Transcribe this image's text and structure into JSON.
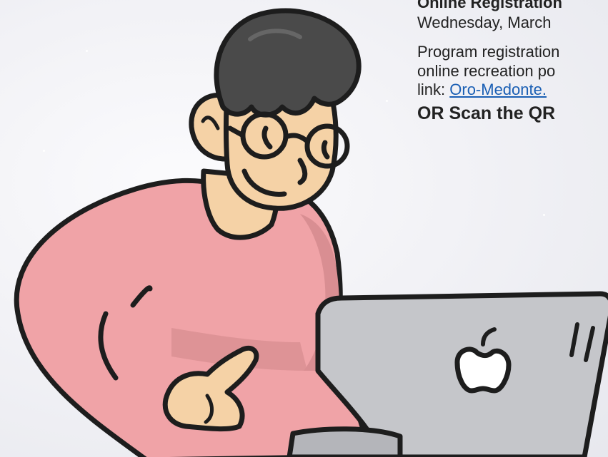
{
  "registration": {
    "title": "Online Registration",
    "date": "Wednesday, March",
    "body_line_1": "Program registration",
    "body_line_2": "online recreation po",
    "link_prefix": "link: ",
    "link_text": "Oro-Medonte.",
    "qr_text": "OR Scan the QR"
  },
  "colors": {
    "sweater": "#f0a3a7",
    "sweater_shadow": "#d98e92",
    "skin": "#f5d2a6",
    "hair": "#4a4a4a",
    "laptop": "#c5c6ca",
    "link": "#1a5fb4"
  }
}
